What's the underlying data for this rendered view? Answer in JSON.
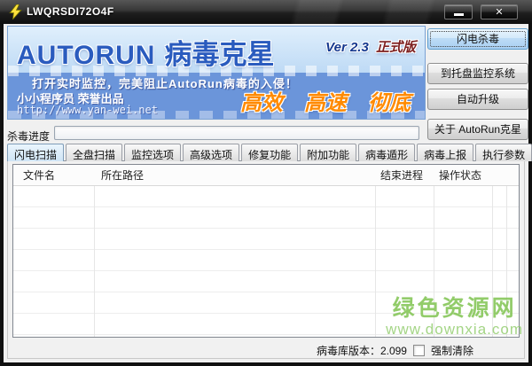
{
  "window": {
    "title": "LWQRSDI72O4F",
    "icons": {
      "titlebar": "lightning-icon",
      "minimize": "minimize-icon",
      "close": "close-icon"
    }
  },
  "banner": {
    "logo_en": "AUTORUN",
    "logo_cn": "病毒克星",
    "version": "Ver 2.3",
    "edition": "正式版",
    "tagline": "打开实时监控，完美阻止AutoRun病毒的入侵！",
    "publisher": "小小程序员 荣誉出品",
    "website": "http://www.yan-wei.net",
    "slogans": [
      "高效",
      "高速",
      "彻底"
    ]
  },
  "actions": {
    "scan": "闪电杀毒",
    "tray": "到托盘监控系统",
    "update": "自动升级",
    "about": "关于 AutoRun克星"
  },
  "progress": {
    "label": "杀毒进度",
    "value_percent": 0
  },
  "tabs": [
    "闪电扫描",
    "全盘扫描",
    "监控选项",
    "高级选项",
    "修复功能",
    "附加功能",
    "病毒遁形",
    "病毒上报",
    "执行参数"
  ],
  "active_tab": "闪电扫描",
  "table": {
    "columns": [
      "文件名",
      "所在路径",
      "结束进程",
      "操作状态"
    ],
    "rows": []
  },
  "statusbar": {
    "db_version": "病毒库版本：2.099",
    "force_clean": "强制清除",
    "force_clean_checked": false
  },
  "watermark": {
    "line1": "绿色资源网",
    "line2": "www.downxia.com"
  },
  "colors": {
    "banner_blue": "#6b95da",
    "logo_blue": "#2a5bbe",
    "slogan_orange": "#ff8a00",
    "edition_red": "#7d1f1f",
    "primary_button_blue": "#bddcf6",
    "watermark_green": "#84c556",
    "titlebar_dark": "#1e1e1e"
  }
}
